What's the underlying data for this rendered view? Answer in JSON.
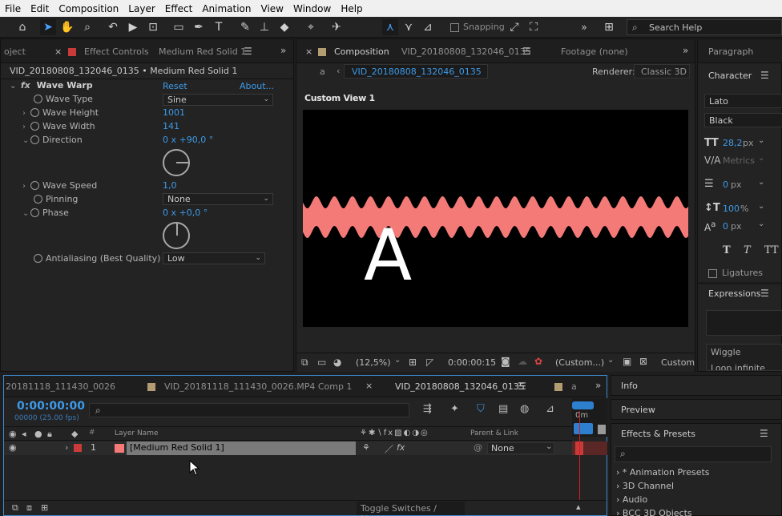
{
  "menu": [
    "File",
    "Edit",
    "Composition",
    "Layer",
    "Effect",
    "Animation",
    "View",
    "Window",
    "Help"
  ],
  "toolbar": {
    "snapping_label": "Snapping",
    "search_placeholder": "Search Help"
  },
  "effect_panel": {
    "tab_project": "oject",
    "tab_prefix": "Effect Controls",
    "tab_layer": "Medium Red Solid 1",
    "path": "VID_20180808_132046_0135 • Medium Red Solid 1",
    "effect_name": "Wave Warp",
    "reset": "Reset",
    "about": "About...",
    "props": {
      "wave_type": {
        "label": "Wave Type",
        "value": "Sine"
      },
      "wave_height": {
        "label": "Wave Height",
        "value": "1001"
      },
      "wave_width": {
        "label": "Wave Width",
        "value": "141"
      },
      "direction": {
        "label": "Direction",
        "value": "0 x +90,0 °"
      },
      "wave_speed": {
        "label": "Wave Speed",
        "value": "1,0"
      },
      "pinning": {
        "label": "Pinning",
        "value": "None"
      },
      "phase": {
        "label": "Phase",
        "value": "0 x +0,0 °"
      },
      "antialiasing": {
        "label": "Antialiasing (Best Quality)",
        "value": "Low"
      }
    }
  },
  "comp_panel": {
    "tab_prefix": "Composition",
    "tab_name": "VID_20180808_132046_0135",
    "footage_tab": "Footage (none)",
    "nav_a": "a",
    "nav_comp": "VID_20180808_132046_0135",
    "renderer_label": "Renderer:",
    "renderer_value": "Classic 3D",
    "view_label": "Custom View 1",
    "letter": "A",
    "wave_color": "#f47a78",
    "zoom": "(12,5%)",
    "timecode": "0:00:00:15",
    "resolution": "(Custom...)",
    "view_mode": "Custom"
  },
  "right_panel": {
    "paragraph": "Paragraph",
    "character": "Character",
    "font": "Lato",
    "style": "Black",
    "font_size": "28,2",
    "font_size_unit": "px",
    "kerning": "Metrics",
    "leading": "0",
    "leading_unit": "px",
    "scale_v": "100",
    "scale_unit": "%",
    "baseline": "0",
    "baseline_unit": "px",
    "ligatures": "Ligatures",
    "expressions": "Expressions",
    "wiggle": "Wiggle",
    "loop": "Loop infinite"
  },
  "timeline": {
    "tab1": "20181118_111430_0026",
    "tab2": "VID_20181118_111430_0026.MP4 Comp 1",
    "tab3": "VID_20180808_132046_0135",
    "tab4": "a",
    "timecode": "0:00:00:00",
    "frames": "00000 (25.00 fps)",
    "col_layer_name": "Layer Name",
    "col_parent": "Parent & Link",
    "layer_num": "1",
    "layer_name": "[Medium Red Solid 1]",
    "layer_color": "#c93b3b",
    "parent_value": "None",
    "ruler": "0m",
    "toggle": "Toggle Switches / Modes"
  },
  "side_panels": {
    "info": "Info",
    "preview": "Preview",
    "effects_presets": "Effects & Presets",
    "items": [
      "* Animation Presets",
      "3D Channel",
      "Audio",
      "BCC 3D Objects"
    ]
  }
}
